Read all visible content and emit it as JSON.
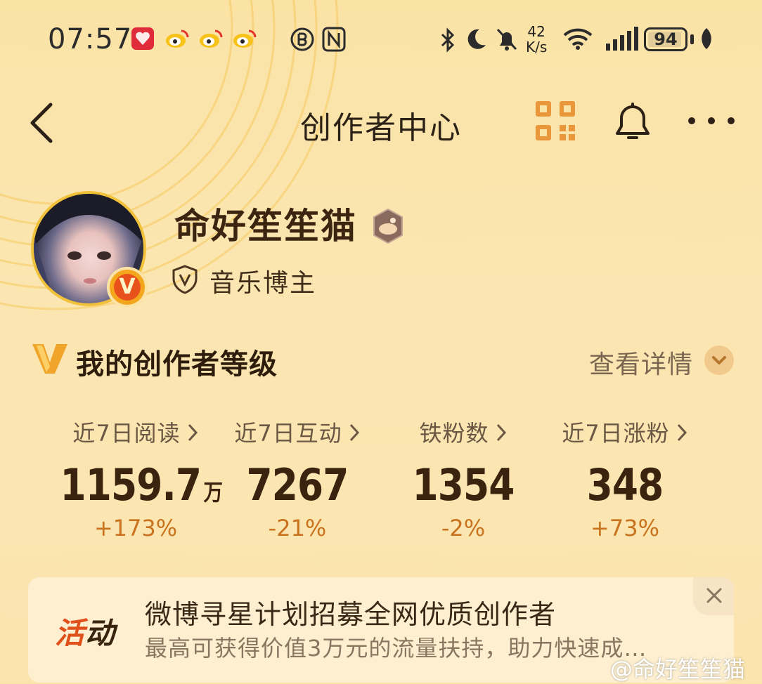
{
  "status_bar": {
    "time": "07:57",
    "net_speed_value": "42",
    "net_speed_unit": "K/s",
    "battery": "94",
    "icons": [
      "app-red-icon",
      "weibo-icon",
      "weibo-icon",
      "weibo-icon",
      "nfc-b-icon",
      "nfc-icon",
      "bluetooth-icon",
      "moon-icon",
      "bell-off-icon",
      "wifi-icon",
      "signal-icon",
      "leaf-icon"
    ]
  },
  "header": {
    "title": "创作者中心"
  },
  "profile": {
    "name": "命好笙笙猫",
    "role": "音乐博主"
  },
  "creator_level": {
    "title": "我的创作者等级",
    "detail_link": "查看详情"
  },
  "stats": [
    {
      "label": "近7日阅读",
      "value": "1159.7",
      "unit": "万",
      "change": "+173%"
    },
    {
      "label": "近7日互动",
      "value": "7267",
      "unit": "",
      "change": "-21%"
    },
    {
      "label": "铁粉数",
      "value": "1354",
      "unit": "",
      "change": "-2%"
    },
    {
      "label": "近7日涨粉",
      "value": "348",
      "unit": "",
      "change": "+73%"
    }
  ],
  "banner": {
    "tag_part1": "活",
    "tag_part2": "动",
    "title": "微博寻星计划招募全网优质创作者",
    "subtitle": "最高可获得价值3万元的流量扶持，助力快速成…"
  },
  "watermark": "@命好笙笙猫",
  "colors": {
    "background": "#fbe3a6",
    "accent_orange": "#c9731f",
    "tag_red": "#e0501a",
    "text_dark": "#3a2410"
  }
}
